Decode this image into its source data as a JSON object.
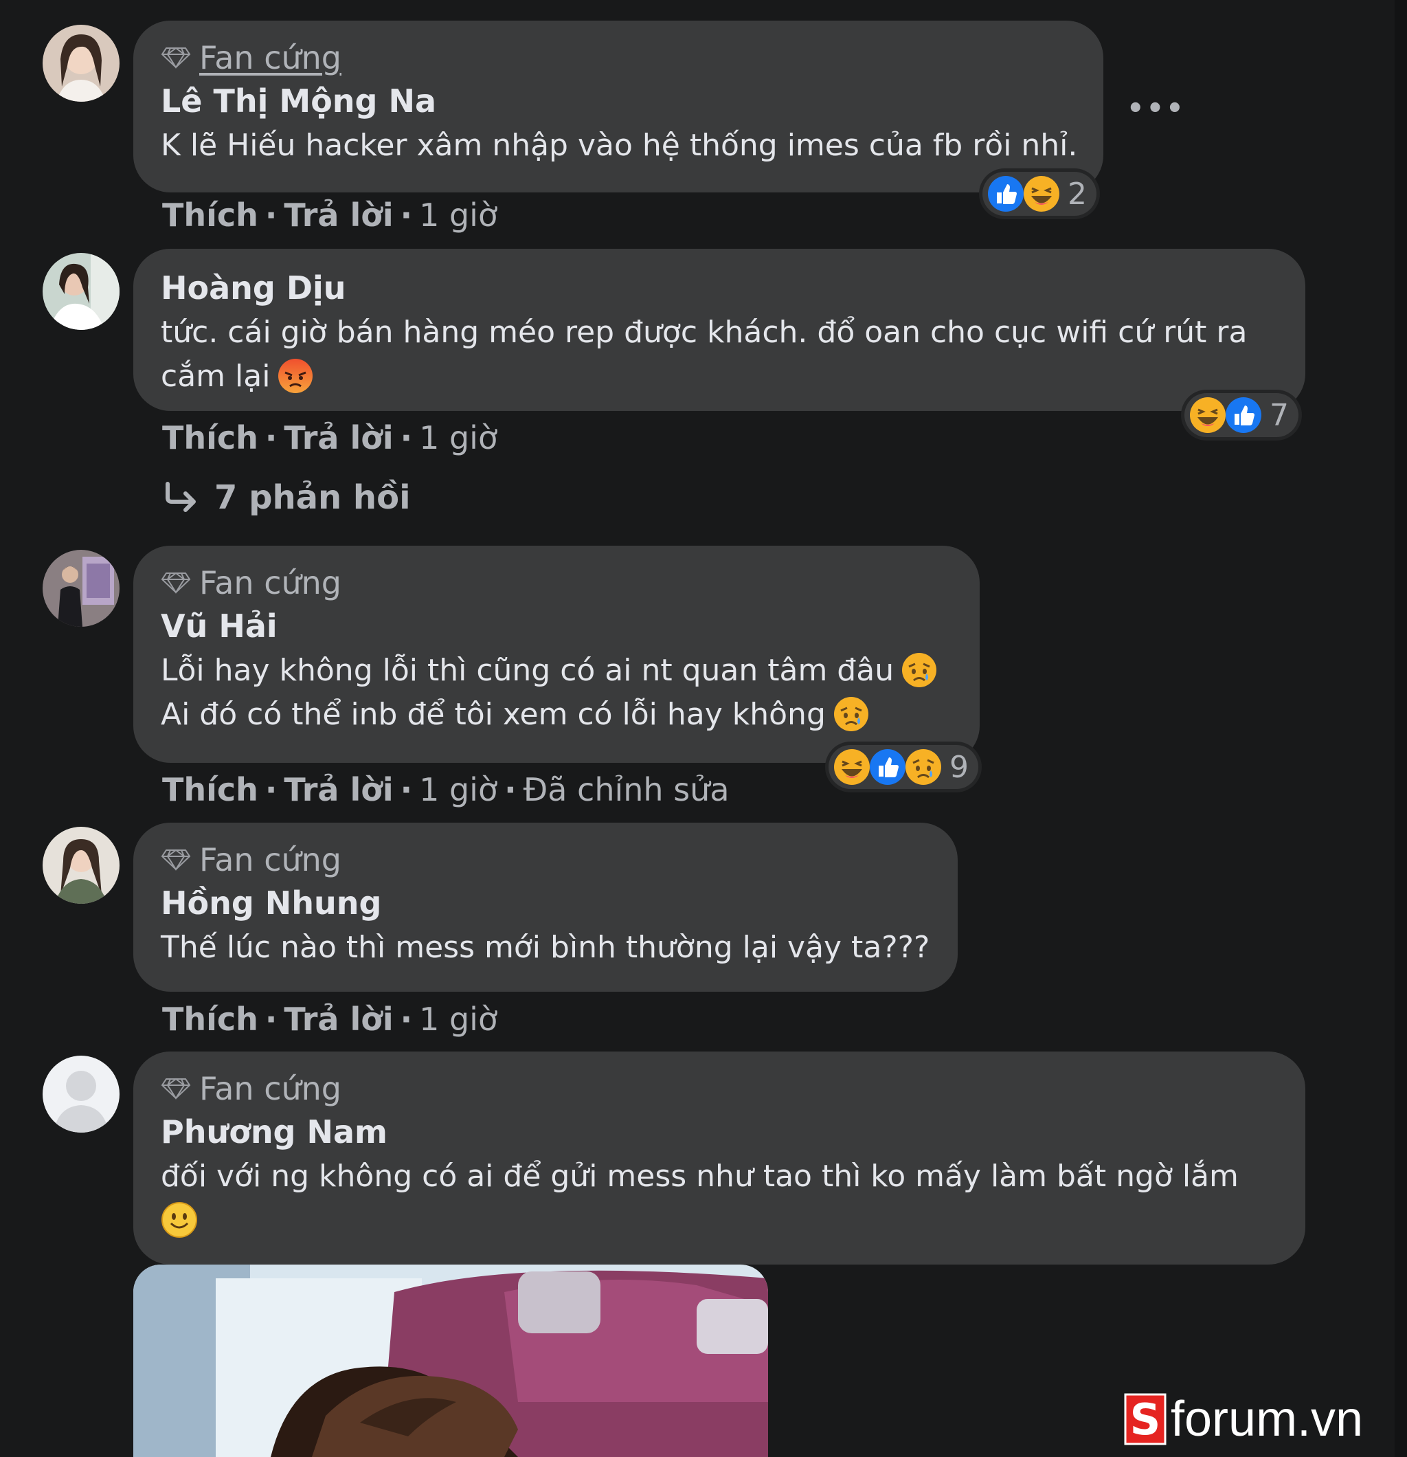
{
  "badge_label": "Fan cứng",
  "like_label": "Thích",
  "reply_label": "Trả lời",
  "comments": [
    {
      "badge": "Fan cứng",
      "author": "Lê Thị Mộng Na",
      "text": "K lẽ Hiếu hacker xâm nhập vào hệ thống imes của fb rồi nhỉ.",
      "reaction_icons": [
        "like",
        "haha"
      ],
      "reaction_count": "2",
      "time": "1 giờ"
    },
    {
      "author": "Hoàng Dịu",
      "text": "tức. cái giờ bán hàng méo rep được khách. đổ oan cho cục wifi cứ rút ra cắm lại",
      "emoji": "angry-face",
      "reaction_icons": [
        "haha",
        "like"
      ],
      "reaction_count": "7",
      "time": "1 giờ",
      "replies": "7 phản hồi"
    },
    {
      "badge": "Fan cứng",
      "author": "Vũ Hải",
      "text_line1": "Lỗi hay không lỗi thì cũng có ai nt quan tâm đâu",
      "text_line2": "Ai đó có thể inb để tôi xem có lỗi hay không",
      "emoji": "sad-face",
      "reaction_icons": [
        "haha",
        "like",
        "sad"
      ],
      "reaction_count": "9",
      "time": "1 giờ",
      "edited": "Đã chỉnh sửa"
    },
    {
      "badge": "Fan cứng",
      "author": "Hồng Nhung",
      "text": "Thế lúc nào thì mess mới bình thường lại vậy ta???",
      "time": "1 giờ"
    },
    {
      "badge": "Fan cứng",
      "author": "Phương Nam",
      "text": "đối với ng không có ai để gửi mess như tao thì ko mấy làm bất ngờ lắm",
      "emoji": "smile-face"
    }
  ],
  "more_options": "•••",
  "watermark": {
    "text": "forum.vn",
    "logo_letter": "S",
    "logo_color": "#e52421"
  },
  "colors": {
    "background": "#18191a",
    "bubble": "#3a3b3c",
    "secondary_text": "#b0b3b8",
    "like_blue": "#1877f2",
    "emoji_yellow": "#f7b125"
  }
}
